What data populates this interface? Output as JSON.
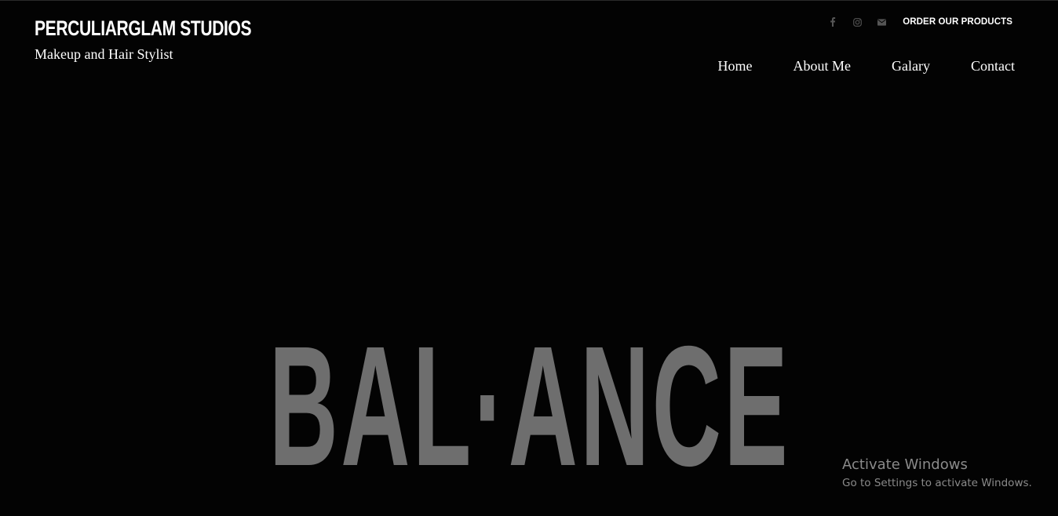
{
  "brand": {
    "title": "PERCULIARGLAM STUDIOS",
    "subtitle": "Makeup and Hair Stylist"
  },
  "topbar": {
    "icons": [
      "facebook-icon",
      "instagram-icon",
      "email-icon"
    ],
    "order_label": "ORDER OUR PRODUCTS"
  },
  "nav": {
    "items": [
      {
        "label": "Home"
      },
      {
        "label": "About Me"
      },
      {
        "label": "Galary"
      },
      {
        "label": "Contact"
      }
    ]
  },
  "hero": {
    "word": "BAL·ANCE"
  },
  "watermark": {
    "title": "Activate Windows",
    "subtitle": "Go to Settings to activate Windows."
  },
  "colors": {
    "background": "#030303",
    "text": "#ffffff",
    "hero_text": "#6e6e6e",
    "icon_muted": "#555555",
    "watermark_text": "#8a8a8a"
  }
}
